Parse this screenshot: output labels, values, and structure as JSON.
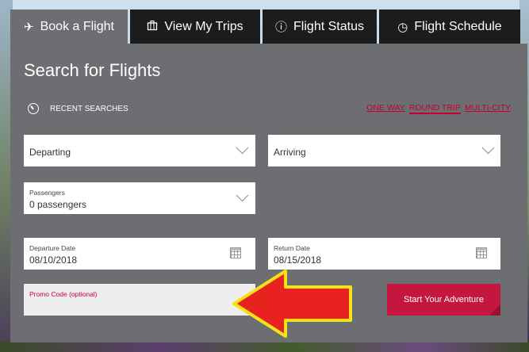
{
  "tabs": [
    {
      "label": "Book a Flight",
      "icon": "airplane-icon",
      "glyph": "✈"
    },
    {
      "label": "View My Trips",
      "icon": "suitcase-icon",
      "glyph": "⛽"
    },
    {
      "label": "Flight Status",
      "icon": "info-icon",
      "glyph": "ⓘ"
    },
    {
      "label": "Flight Schedule",
      "icon": "clock-icon",
      "glyph": "◷"
    }
  ],
  "form": {
    "title": "Search for Flights",
    "recent_searches": "RECENT SEARCHES",
    "trip_types": [
      "ONE WAY",
      "ROUND TRIP",
      "MULTI-CITY"
    ],
    "selected_trip_type": "ROUND TRIP",
    "departing": "Departing",
    "arriving": "Arriving",
    "passengers_label": "Passengers",
    "passengers_value": "0 passengers",
    "departure_date_label": "Departure Date",
    "departure_date_value": "08/10/2018",
    "return_date_label": "Return Date",
    "return_date_value": "08/15/2018",
    "promo_label": "Promo Code (optional)",
    "submit": "Start Your Adventure"
  },
  "colors": {
    "accent": "#c4163f",
    "panel": "#6d6e71",
    "tab_inactive": "#1c1c1c",
    "annotation_arrow": "#e8231f",
    "annotation_outline": "#f5e21b"
  }
}
